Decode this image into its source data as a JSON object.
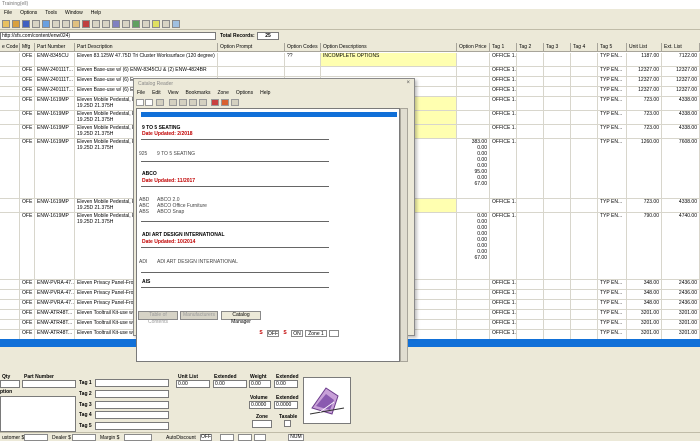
{
  "window": {
    "title": "Training(ell)"
  },
  "menu": [
    "File",
    "Options",
    "Tools",
    "Window",
    "Help"
  ],
  "addressbar": {
    "url": "http://sfs.com/content/enw024)",
    "total_records_label": "Total Records:",
    "total_records_value": "25"
  },
  "grid": {
    "headers": [
      "e Code",
      "Mfg",
      "Part Number",
      "Part Description",
      "Option Prompt",
      "Option Codes",
      "Option Descriptions",
      "Option Price",
      "Tag 1",
      "Tag 2",
      "Tag 3",
      "Tag 4",
      "Tag 5",
      "Unit List",
      "Ext. List"
    ],
    "rows": [
      {
        "mfg": "OFE",
        "part": "ENW-8345CU",
        "desc": "Eleven 83.125W 47.75D Tri Cluster Worksurface (120 degree)",
        "optcodes": "??",
        "optdesc": "INCOMPLETE OPTIONS",
        "tag1": "OFFICE 1...",
        "tag5": "TYP EN...",
        "unit": "1187.00",
        "ext": "7122.00"
      },
      {
        "mfg": "OFE",
        "part": "ENW-240111T...",
        "desc": "Eleven Base-use w/ (6) ENW-8345CU & (2) ENW-4824BR",
        "tag1": "OFFICE 1...",
        "tag5": "TYP EN...",
        "unit": "12327.00",
        "ext": "12327.00"
      },
      {
        "mfg": "OFE",
        "part": "ENW-240111T...",
        "desc": "Eleven Base-use w/ (6) E",
        "tag1": "OFFICE 1...",
        "tag5": "TYP EN...",
        "unit": "12327.00",
        "ext": "12327.00"
      },
      {
        "mfg": "OFE",
        "part": "ENW-240111T...",
        "desc": "Eleven Base-use w/ (6) E",
        "tag1": "OFFICE 1...",
        "tag5": "TYP EN...",
        "unit": "12327.00",
        "ext": "12327.00"
      },
      {
        "mfg": "OFE",
        "part": "ENW-1619MP",
        "desc": "Eleven Mobile Pedestal, E\n19.25D 21.375H",
        "tag1": "OFFICE 1...",
        "tag5": "TYP EN...",
        "unit": "723.00",
        "ext": "4338.00"
      },
      {
        "mfg": "OFE",
        "part": "ENW-1619MP",
        "desc": "Eleven Mobile Pedestal, E\n19.25D 21.375H",
        "tag1": "OFFICE 1...",
        "tag5": "TYP EN...",
        "unit": "723.00",
        "ext": "4338.00"
      },
      {
        "mfg": "OFE",
        "part": "ENW-1619MP",
        "desc": "Eleven Mobile Pedestal, E\n19.25D 21.375H",
        "tag1": "OFFICE 1...",
        "tag5": "TYP EN...",
        "unit": "723.00",
        "ext": "4338.00"
      },
      {
        "mfg": "OFE",
        "part": "ENW-1619MP",
        "desc": "Eleven Mobile Pedestal, E\n19.25D 21.375H",
        "optprice": "383.00\n0.00\n0.00\n0.00\n0.00\n95.00\n0.00\n67.00",
        "tag1": "OFFICE 1...",
        "tag5": "TYP EN...",
        "unit": "1260.00",
        "ext": "7608.00"
      },
      {
        "mfg": "OFE",
        "part": "ENW-1619MP",
        "desc": "Eleven Mobile Pedestal, E\n19.25D 21.375H",
        "tag1": "OFFICE 1...",
        "tag5": "TYP EN...",
        "unit": "723.00",
        "ext": "4338.00"
      },
      {
        "mfg": "OFE",
        "part": "ENW-1619MP",
        "desc": "Eleven Mobile Pedestal, E\n19.25D 21.375H",
        "optprice": "0.00\n0.00\n0.00\n0.00\n0.00\n0.00\n0.00\n67.00",
        "tag1": "OFFICE 1...",
        "tag5": "TYP EN...",
        "unit": "790.00",
        "ext": "4740.00"
      },
      {
        "mfg": "OFE",
        "part": "ENW-PVRA-47...",
        "desc": "Eleven Privacy Panel-Fro",
        "tag1": "OFFICE 1...",
        "tag5": "TYP EN...",
        "unit": "348.00",
        "ext": "2436.00"
      },
      {
        "mfg": "OFE",
        "part": "ENW-PVRA-47...",
        "desc": "Eleven Privacy Panel-Fro",
        "tag1": "OFFICE 1...",
        "tag5": "TYP EN...",
        "unit": "348.00",
        "ext": "2436.00"
      },
      {
        "mfg": "OFE",
        "part": "ENW-PVRA-47...",
        "desc": "Eleven Privacy Panel-Fro",
        "tag1": "OFFICE 1...",
        "tag5": "TYP EN...",
        "unit": "348.00",
        "ext": "2436.00"
      },
      {
        "mfg": "OFE",
        "part": "ENW-ATR48T...",
        "desc": "Eleven Tooltrail Kit-use w",
        "tag1": "OFFICE 1...",
        "tag5": "TYP EN...",
        "unit": "3201.00",
        "ext": "3201.00"
      },
      {
        "mfg": "OFE",
        "part": "ENW-ATR48T...",
        "desc": "Eleven Tooltrail Kit-use w",
        "tag1": "OFFICE 1...",
        "tag5": "TYP EN...",
        "unit": "3201.00",
        "ext": "3201.00"
      },
      {
        "mfg": "OFE",
        "part": "ENW-ATR48T...",
        "desc": "Eleven Tooltrail Kit-use w",
        "tag1": "OFFICE 1...",
        "tag5": "TYP EN...",
        "unit": "3201.00",
        "ext": "3201.00"
      }
    ]
  },
  "catalog": {
    "title": "Catalog Reader",
    "close": "×",
    "menu": [
      "File",
      "Edit",
      "View",
      "Bookmarks",
      "Zone",
      "Options",
      "Help"
    ],
    "entries": [
      {
        "name": "9 TO 5 SEATING",
        "date": "Date Updated: 2/2018",
        "codes": [
          {
            "code": "925",
            "text": "9 TO 5 SEATING"
          }
        ]
      },
      {
        "name": "ABCO",
        "date": "Date Updated: 11/2017",
        "codes": [
          {
            "code": "ABD",
            "text": "ABCO 2.0"
          },
          {
            "code": "ABC",
            "text": "ABCO Office Furniture"
          },
          {
            "code": "ABS",
            "text": "ABCO Snap"
          }
        ]
      },
      {
        "name": "ADI ART DESIGN INTERNATIONAL",
        "date": "Date Updated: 10/2014",
        "codes": [
          {
            "code": "ADI",
            "text": "ADI ART DESIGN INTERNATIONAL"
          }
        ]
      },
      {
        "name": "AIS",
        "date": "",
        "codes": []
      }
    ],
    "buttons": {
      "toc": "Table of Contents",
      "manufacturers": "Manufacturers",
      "catalog_manager": "Catalog Manager"
    },
    "status": {
      "s_label": "S",
      "off": "OFF",
      "s2_label": "S",
      "on": "ON",
      "zone": "Zone 1"
    }
  },
  "bottom": {
    "qty": "Qty",
    "part_number": "Part Number",
    "ption": "ption",
    "tags": [
      "Tag 1",
      "Tag 2",
      "Tag 3",
      "Tag 4",
      "Tag 5"
    ],
    "unit_list": "Unit List",
    "unit_list_value": "0.00",
    "extended": "Extended",
    "extended_value": "0.00",
    "weight": "Weight",
    "weight_value": "0.00",
    "extended2": "Extended",
    "extended2_value": "0.00",
    "volume": "Volume",
    "volume_value": "0.0000",
    "extended3": "Extended",
    "extended3_value": "0.0000",
    "zone": "Zone",
    "taxable": "Taxable"
  },
  "statusbar": {
    "customer": "ustomer $",
    "dealer": "Dealer $",
    "margin": "Margin $",
    "autodiscount": "AutoDiscount",
    "off": "OFF",
    "num": "NUM"
  }
}
